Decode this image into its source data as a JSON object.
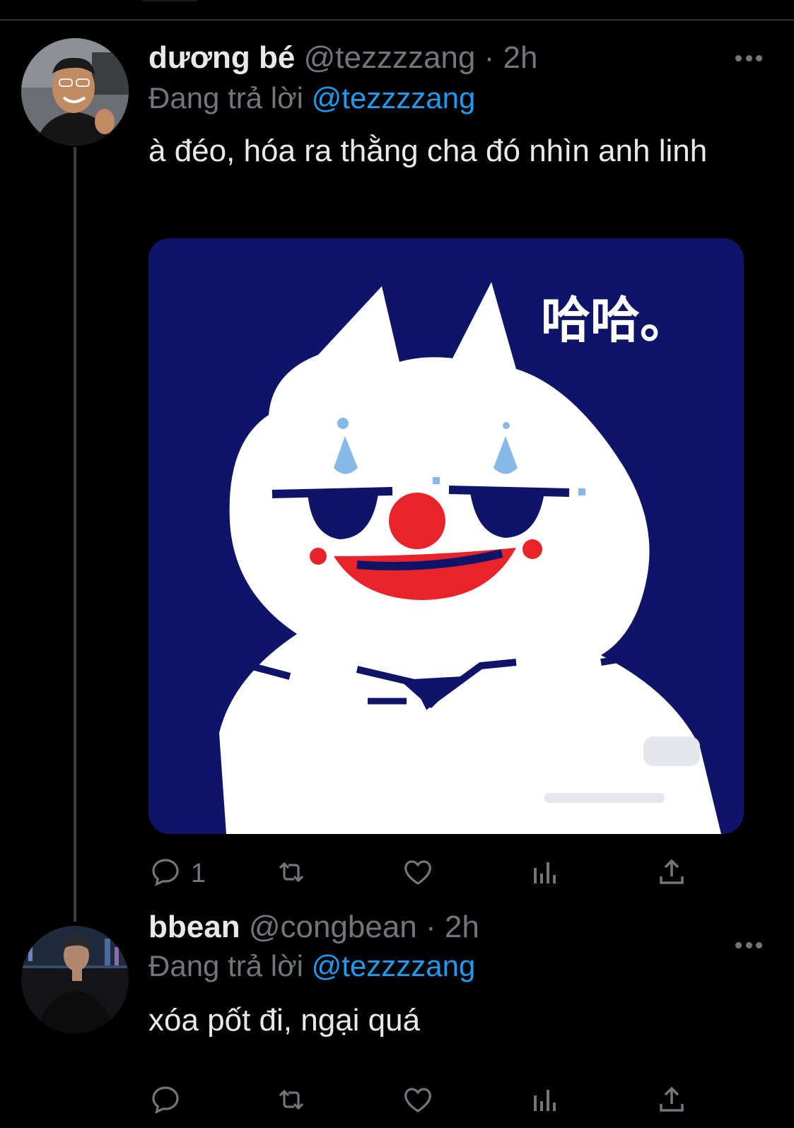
{
  "tweets": [
    {
      "display_name": "dương bé",
      "handle": "@tezzzzang",
      "time": "2h",
      "replying_prefix": "Đang trả lời",
      "replying_to": "@tezzzzang",
      "text": "à đéo, hóa ra thằng cha đó nhìn anh linh",
      "has_media": true,
      "media_caption": "哈哈。",
      "reply_count": "1",
      "retweet_count": "",
      "like_count": ""
    },
    {
      "display_name": "bbean",
      "handle": "@congbean",
      "time": "2h",
      "replying_prefix": "Đang trả lời",
      "replying_to": "@tezzzzang",
      "text": "xóa pốt đi, ngại quá",
      "has_media": false,
      "reply_count": "",
      "retweet_count": "",
      "like_count": ""
    }
  ],
  "meta_separator": "·",
  "colors": {
    "background": "#000000",
    "text": "#e7e9ea",
    "muted": "#71767b",
    "accent": "#1d9bf0",
    "media_bg": "#0f1469",
    "clown_nose": "#e8232a",
    "clown_tear": "#86b9e8"
  },
  "icons": [
    "more-icon",
    "reply-icon",
    "retweet-icon",
    "like-icon",
    "analytics-icon",
    "share-icon"
  ]
}
